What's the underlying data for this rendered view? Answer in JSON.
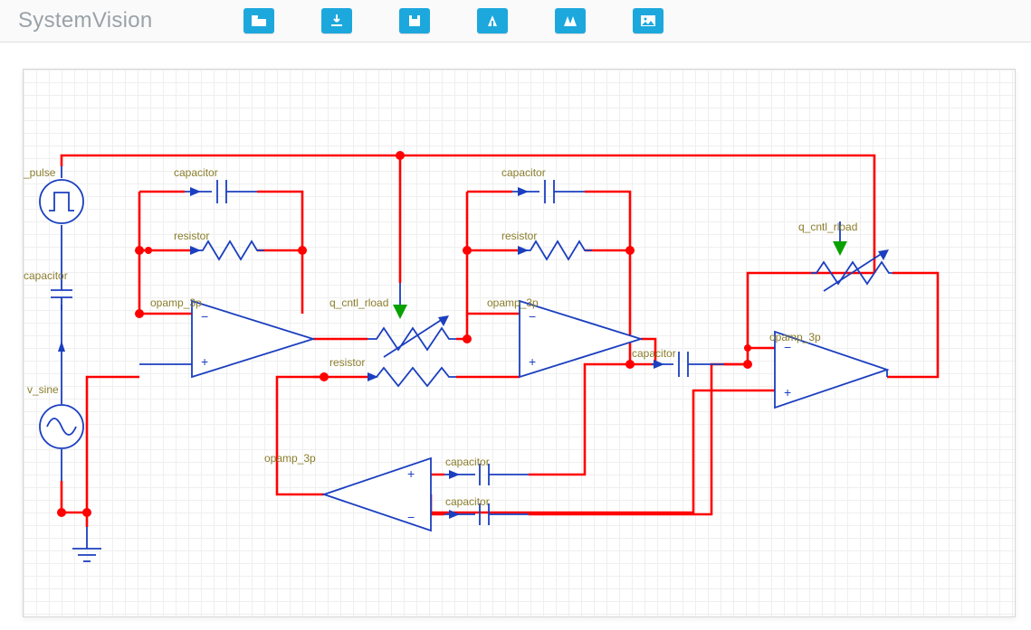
{
  "header": {
    "app_title": "SystemVision",
    "buttons": [
      {
        "name": "folder-icon"
      },
      {
        "name": "download-icon"
      },
      {
        "name": "save-icon"
      },
      {
        "name": "run-icon"
      },
      {
        "name": "run-fast-icon"
      },
      {
        "name": "image-icon"
      }
    ]
  },
  "schematic": {
    "labels": {
      "v_pulse": "_pulse",
      "capacitor_vert": "capacitor",
      "v_sine": "v_sine",
      "cap_top1": "capacitor",
      "cap_top2": "capacitor",
      "res_fb1": "resistor",
      "res_fb2": "resistor",
      "opamp1": "opamp_3p",
      "opamp2": "opamp_3p",
      "opamp3": "opamp_3p",
      "opamp4": "opamp_3p",
      "q_cntl1": "q_cntl_rload",
      "q_cntl2": "q_cntl_rload",
      "res_mid": "resistor",
      "cap_mid": "capacitor",
      "cap_bot1": "capacitor",
      "cap_bot2": "capacitor"
    }
  }
}
